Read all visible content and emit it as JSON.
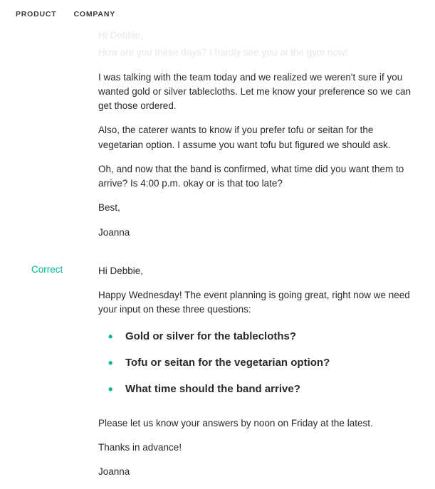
{
  "nav": {
    "product": "PRODUCT",
    "company": "COMPANY"
  },
  "faded": {
    "greeting": "Hi Debbie,",
    "line2": "How are you these days? I hardly see you at the gym now!"
  },
  "wrong": {
    "p1": "I was talking with the team today and we realized we weren't sure if you wanted gold or silver tablecloths. Let me know your preference so we can get those ordered.",
    "p2": "Also, the caterer wants to know if you prefer tofu or seitan for the vegetarian option. I assume you want tofu but figured we should ask.",
    "p3": "Oh, and now that the band is confirmed, what time did you want them to arrive? Is 4:00 p.m. okay or is that too late?",
    "closing": "Best,",
    "sign": "Joanna"
  },
  "correct": {
    "label": "Correct",
    "greeting": "Hi Debbie,",
    "intro": "Happy Wednesday! The event planning is going great, right now we need your input on these three questions:",
    "bullets": [
      "Gold or silver for the tablecloths?",
      "Tofu or seitan for the vegetarian option?",
      "What time should the band arrive?"
    ],
    "outro": "Please let us know your answers by noon on Friday at the latest.",
    "thanks": "Thanks in advance!",
    "sign": "Joanna"
  }
}
